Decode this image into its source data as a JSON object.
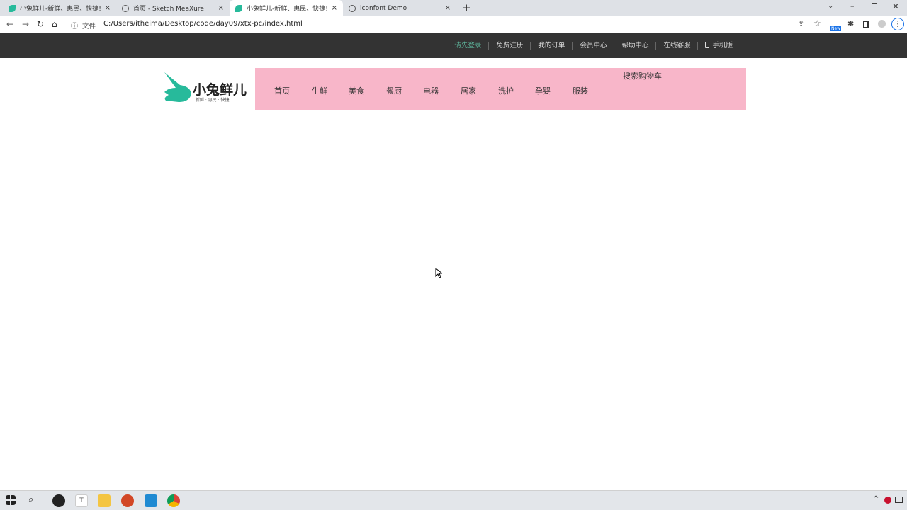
{
  "browser": {
    "tabs": [
      {
        "title": "小兔鲜儿-新鲜、惠民、快捷!",
        "icon": "rabbit-icon",
        "active": false
      },
      {
        "title": "首页 - Sketch MeaXure",
        "icon": "globe-icon",
        "active": false
      },
      {
        "title": "小兔鲜儿-新鲜、惠民、快捷!",
        "icon": "rabbit-icon",
        "active": true
      },
      {
        "title": "iconfont Demo",
        "icon": "globe-icon",
        "active": false
      }
    ],
    "close_glyph": "×",
    "new_tab": "+",
    "file_label": "文件",
    "url": "C:/Users/itheima/Desktop/code/day09/xtx-pc/index.html",
    "new_badge": "New"
  },
  "topnav": {
    "items": [
      "请先登录",
      "免费注册",
      "我的订单",
      "会员中心",
      "帮助中心",
      "在线客服",
      "手机版"
    ],
    "accent": "#5eb69c"
  },
  "logo": {
    "name": "小兔鲜儿",
    "slogan": "新鲜 · 惠民 · 快捷"
  },
  "nav": {
    "items": [
      "首页",
      "生鲜",
      "美食",
      "餐厨",
      "电器",
      "居家",
      "洗护",
      "孕婴",
      "服装"
    ],
    "search_text": "搜索购物车",
    "bg": "#f8b6c9"
  }
}
